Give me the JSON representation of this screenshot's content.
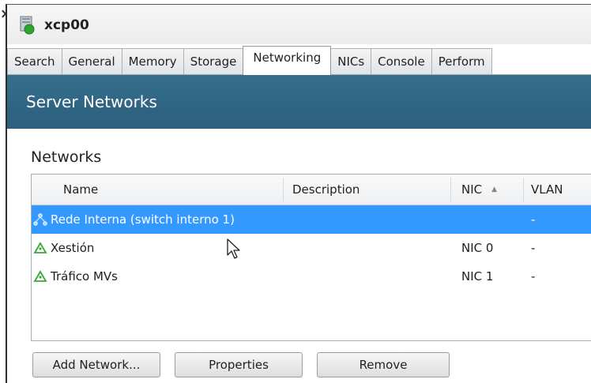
{
  "window": {
    "title": "xcp00",
    "server_icon": "server-icon",
    "status_color": "#2fa52f"
  },
  "tabs": [
    {
      "label": "Search",
      "active": false
    },
    {
      "label": "General",
      "active": false
    },
    {
      "label": "Memory",
      "active": false
    },
    {
      "label": "Storage",
      "active": false
    },
    {
      "label": "Networking",
      "active": true
    },
    {
      "label": "NICs",
      "active": false
    },
    {
      "label": "Console",
      "active": false
    },
    {
      "label": "Perform",
      "active": false
    }
  ],
  "section": {
    "title": "Server Networks",
    "color": "#2f6685"
  },
  "networks": {
    "label": "Networks",
    "columns": {
      "name": "Name",
      "description": "Description",
      "nic": "NIC",
      "vlan": "VLAN"
    },
    "sort_indicator": "▲",
    "rows": [
      {
        "name": "Rede Interna (switch interno 1)",
        "description": "",
        "nic": "",
        "vlan": "-",
        "selected": true,
        "icon": "internal-network-icon"
      },
      {
        "name": "Xestión",
        "description": "",
        "nic": "NIC 0",
        "vlan": "-",
        "selected": false,
        "icon": "network-icon"
      },
      {
        "name": "Tráfico MVs",
        "description": "",
        "nic": "NIC 1",
        "vlan": "-",
        "selected": false,
        "icon": "network-icon"
      }
    ]
  },
  "buttons": {
    "add_network": "Add Network...",
    "properties": "Properties",
    "remove": "Remove"
  },
  "colors": {
    "selection": "#3399ff",
    "header_band": "#2f6685",
    "network_icon": "#3aa63a"
  }
}
